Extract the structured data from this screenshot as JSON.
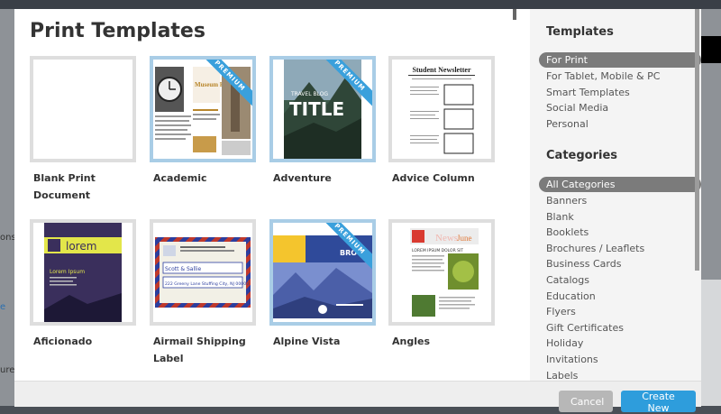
{
  "page_title": "Print Templates",
  "templates": [
    {
      "label": "Blank Print Document",
      "premium": false
    },
    {
      "label": "Academic",
      "premium": true
    },
    {
      "label": "Adventure",
      "premium": true
    },
    {
      "label": "Advice Column",
      "premium": false
    },
    {
      "label": "Aficionado",
      "premium": false
    },
    {
      "label": "Airmail Shipping Label",
      "premium": false
    },
    {
      "label": "Alpine Vista",
      "premium": true
    },
    {
      "label": "Angles",
      "premium": false
    }
  ],
  "ribbon_text": "PREMIUM",
  "thumbs": {
    "academic": {
      "heading": "Museum History"
    },
    "adventure": {
      "small": "TRAVEL BLOG",
      "big": "TITLE"
    },
    "advice": {
      "heading": "Student Newsletter"
    },
    "aficionado": {
      "heading": "lorem",
      "sub": "Lorem Ipsum"
    },
    "airmail": {
      "name": "Scott & Sallie",
      "address": "222 Greeny Lane Stuffing City, NJ 00000"
    },
    "alpine": {
      "heading": "BRO"
    },
    "angles": {
      "heading": "News",
      "accent": "June",
      "sub": "LOREM IPSUM DOLOR SIT"
    }
  },
  "sidebar": {
    "templates_heading": "Templates",
    "template_items": [
      {
        "label": "For Print",
        "active": true
      },
      {
        "label": "For Tablet, Mobile & PC",
        "active": false
      },
      {
        "label": "Smart Templates",
        "active": false
      },
      {
        "label": "Social Media",
        "active": false
      },
      {
        "label": "Personal",
        "active": false
      }
    ],
    "categories_heading": "Categories",
    "category_items": [
      {
        "label": "All Categories",
        "active": true
      },
      {
        "label": "Banners",
        "active": false
      },
      {
        "label": "Blank",
        "active": false
      },
      {
        "label": "Booklets",
        "active": false
      },
      {
        "label": "Brochures / Leaflets",
        "active": false
      },
      {
        "label": "Business Cards",
        "active": false
      },
      {
        "label": "Catalogs",
        "active": false
      },
      {
        "label": "Education",
        "active": false
      },
      {
        "label": "Flyers",
        "active": false
      },
      {
        "label": "Gift Certificates",
        "active": false
      },
      {
        "label": "Holiday",
        "active": false
      },
      {
        "label": "Invitations",
        "active": false
      },
      {
        "label": "Labels",
        "active": false
      }
    ]
  },
  "footer": {
    "cancel_label": "Cancel",
    "create_label": "Create New"
  },
  "backdrop": {
    "frag1": "ons",
    "frag2": "e",
    "frag3": "ures"
  },
  "colors": {
    "accent": "#2e9ddc",
    "premium_ribbon": "#3aa0dc",
    "active_item": "#7b7b7b"
  }
}
